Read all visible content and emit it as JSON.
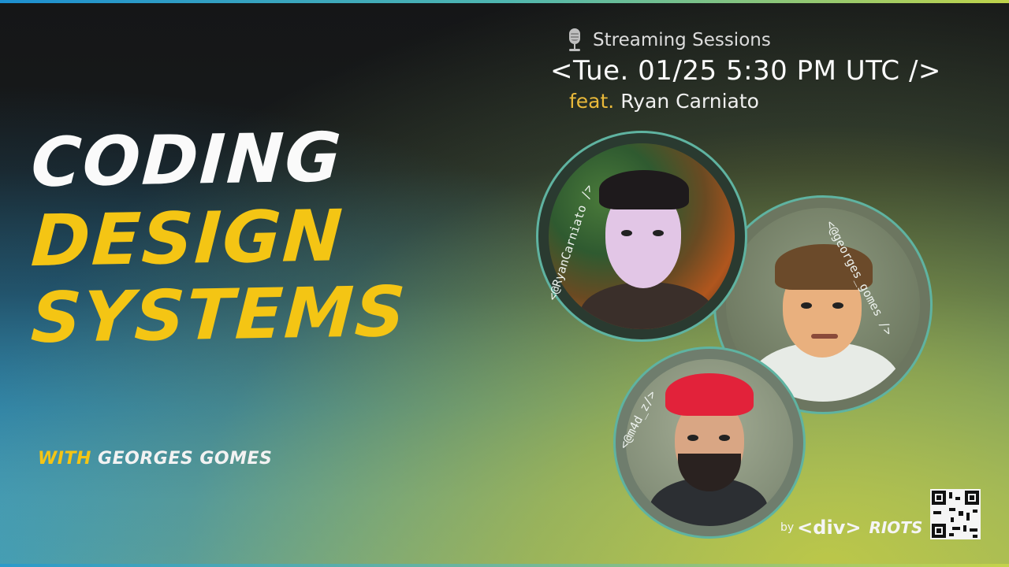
{
  "title": {
    "line1": "CODING",
    "line2": "DESIGN",
    "line3": "SYSTEMS"
  },
  "byline": {
    "with": "WITH",
    "name": "GEORGES GOMES"
  },
  "event": {
    "category": "Streaming Sessions",
    "datetime": "<Tue. 01/25 5:30 PM UTC />",
    "feat_label": "feat.",
    "feat_name": "Ryan Carniato"
  },
  "guests": [
    {
      "handle": "<@RyanCarniato />",
      "icon": "avatar-photo"
    },
    {
      "handle": "<@georges_gomes />",
      "icon": "avatar-pixel"
    },
    {
      "handle": "<@m4d_z/>",
      "icon": "avatar-pixel"
    }
  ],
  "branding": {
    "by": "by",
    "logo_tag": "<div>",
    "logo_name": "RIOTS"
  },
  "colors": {
    "accent_yellow": "#f4c514",
    "ring": "#5fb3a1",
    "feat": "#e9b93a"
  }
}
